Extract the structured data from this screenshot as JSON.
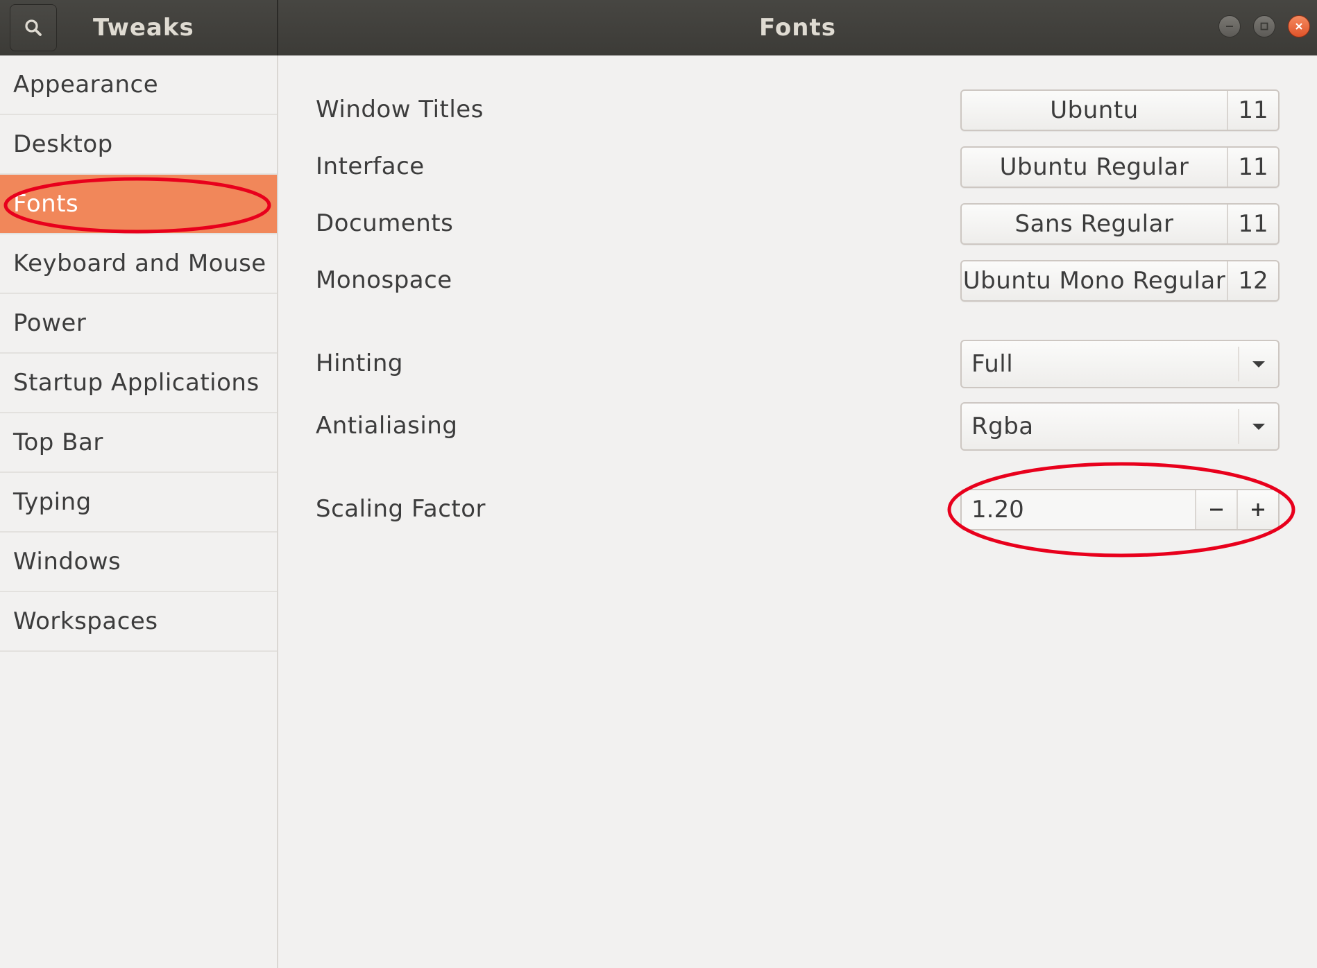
{
  "header": {
    "left_title": "Tweaks",
    "right_title": "Fonts"
  },
  "sidebar": {
    "items": [
      {
        "label": "Appearance"
      },
      {
        "label": "Desktop"
      },
      {
        "label": "Fonts"
      },
      {
        "label": "Keyboard and Mouse"
      },
      {
        "label": "Power"
      },
      {
        "label": "Startup Applications"
      },
      {
        "label": "Top Bar"
      },
      {
        "label": "Typing"
      },
      {
        "label": "Windows"
      },
      {
        "label": "Workspaces"
      }
    ],
    "selected_index": 2
  },
  "fonts": {
    "window_titles": {
      "label": "Window Titles",
      "font": "Ubuntu",
      "size": "11"
    },
    "interface": {
      "label": "Interface",
      "font": "Ubuntu Regular",
      "size": "11"
    },
    "documents": {
      "label": "Documents",
      "font": "Sans Regular",
      "size": "11"
    },
    "monospace": {
      "label": "Monospace",
      "font": "Ubuntu Mono Regular",
      "size": "12"
    }
  },
  "hinting": {
    "label": "Hinting",
    "value": "Full"
  },
  "antialiasing": {
    "label": "Antialiasing",
    "value": "Rgba"
  },
  "scaling": {
    "label": "Scaling Factor",
    "value": "1.20"
  },
  "colors": {
    "accent": "#f1875a",
    "headerbar": "#3c3b37",
    "annotation": "#e8001c"
  },
  "icons": {
    "search": "search-icon",
    "minimize": "minimize-icon",
    "maximize": "maximize-icon",
    "close": "close-icon",
    "dropdown": "chevron-down-icon",
    "decrement": "minus-icon",
    "increment": "plus-icon"
  }
}
